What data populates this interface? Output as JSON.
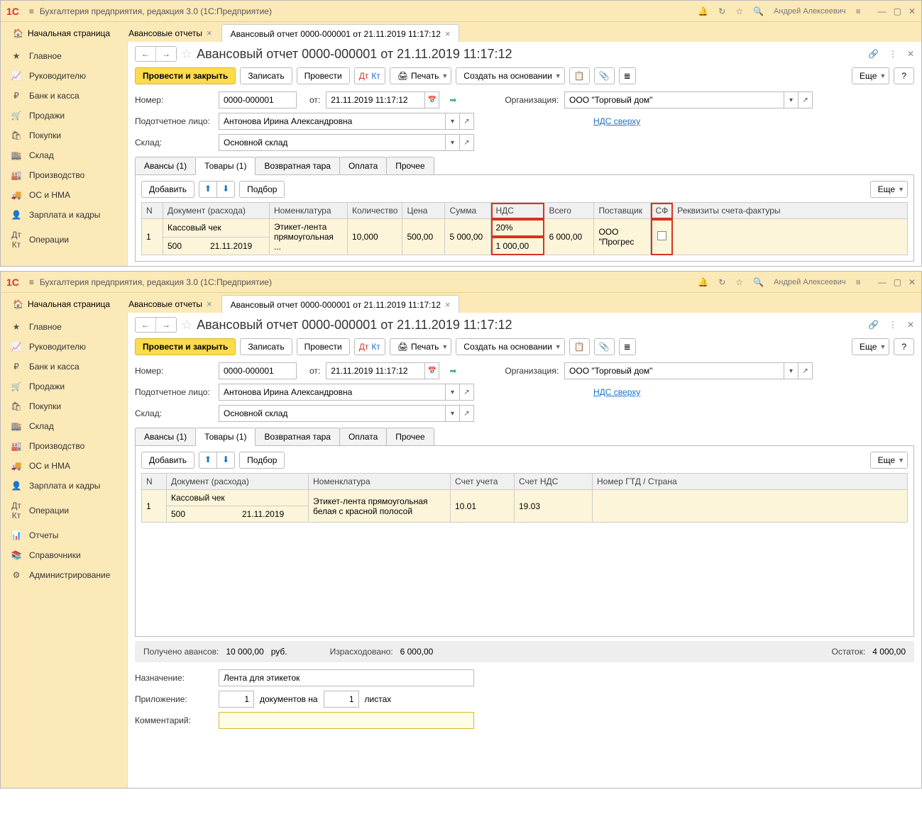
{
  "app_title": "Бухгалтерия предприятия, редакция 3.0  (1С:Предприятие)",
  "user": "Андрей Алексеевич",
  "page_tabs": {
    "home": "Начальная страница",
    "reports": "Авансовые отчеты",
    "doc": "Авансовый отчет 0000-000001 от 21.11.2019 11:17:12"
  },
  "sidebar": [
    "Главное",
    "Руководителю",
    "Банк и касса",
    "Продажи",
    "Покупки",
    "Склад",
    "Производство",
    "ОС и НМА",
    "Зарплата и кадры",
    "Операции",
    "Отчеты",
    "Справочники",
    "Администрирование"
  ],
  "doc_title": "Авансовый отчет 0000-000001 от 21.11.2019 11:17:12",
  "btns": {
    "post_close": "Провести и закрыть",
    "write": "Записать",
    "post": "Провести",
    "print": "Печать",
    "create_based": "Создать на основании",
    "more": "Еще",
    "help": "?",
    "add": "Добавить",
    "select": "Подбор"
  },
  "fields": {
    "number_l": "Номер:",
    "number_v": "0000-000001",
    "from_l": "от:",
    "date_v": "21.11.2019 11:17:12",
    "org_l": "Организация:",
    "org_v": "ООО \"Торговый дом\"",
    "person_l": "Подотчетное лицо:",
    "person_v": "Антонова Ирина Александровна",
    "vat_link": "НДС сверху",
    "store_l": "Склад:",
    "store_v": "Основной склад"
  },
  "tabs": [
    "Авансы (1)",
    "Товары (1)",
    "Возвратная тара",
    "Оплата",
    "Прочее"
  ],
  "table1": {
    "headers": [
      "N",
      "Документ (расхода)",
      "Номенклатура",
      "Количество",
      "Цена",
      "Сумма",
      "НДС",
      "Всего",
      "Поставщик",
      "СФ",
      "Реквизиты счета-фактуры"
    ],
    "row": {
      "n": "1",
      "doc": "Кассовый чек",
      "doc2": "500",
      "doc3": "21.11.2019",
      "nom": "Этикет-лента прямоугольная ...",
      "qty": "10,000",
      "price": "500,00",
      "sum": "5 000,00",
      "vat": "20%",
      "vat2": "1 000,00",
      "total": "6 000,00",
      "supplier": "ООО \"Прогрес"
    }
  },
  "table2": {
    "headers": [
      "N",
      "Документ (расхода)",
      "Номенклатура",
      "Счет учета",
      "Счет НДС",
      "Номер ГТД / Страна"
    ],
    "row": {
      "n": "1",
      "doc": "Кассовый чек",
      "doc2": "500",
      "doc3": "21.11.2019",
      "nom": "Этикет-лента прямоугольная белая с красной полосой",
      "acct": "10.01",
      "vat_acct": "19.03"
    }
  },
  "summary": {
    "recv_l": "Получено авансов:",
    "recv_v": "10 000,00",
    "cur": "руб.",
    "spent_l": "Израсходовано:",
    "spent_v": "6 000,00",
    "rest_l": "Остаток:",
    "rest_v": "4 000,00"
  },
  "bottom": {
    "purpose_l": "Назначение:",
    "purpose_v": "Лента для этикеток",
    "attach_l": "Приложение:",
    "attach_v1": "1",
    "attach_t1": "документов на",
    "attach_v2": "1",
    "attach_t2": "листах",
    "comment_l": "Комментарий:"
  }
}
